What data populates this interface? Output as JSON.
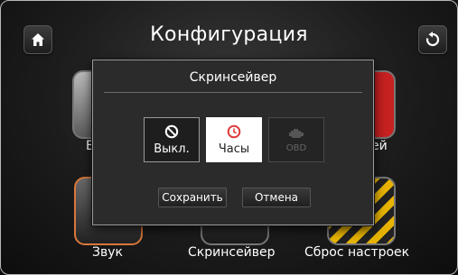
{
  "header": {
    "title": "Конфигурация",
    "home_icon": "home-icon",
    "back_icon": "back-refresh-icon"
  },
  "background_tiles": [
    {
      "label": "В"
    },
    {
      "label": "ей"
    },
    {
      "label": "Звук"
    },
    {
      "label": "Скринсейвер"
    },
    {
      "label": "Сброс настроек"
    }
  ],
  "modal": {
    "title": "Скринсейвер",
    "options": [
      {
        "label": "Выкл.",
        "icon": "no-icon",
        "selected": false,
        "enabled": true
      },
      {
        "label": "Часы",
        "icon": "clock-icon",
        "selected": true,
        "enabled": true
      },
      {
        "label": "OBD",
        "icon": "engine-icon",
        "selected": false,
        "enabled": false
      }
    ],
    "save_label": "Сохранить",
    "cancel_label": "Отмена"
  },
  "colors": {
    "accent_red": "#e03b3b",
    "selected_bg": "#ffffff",
    "modal_bg": "#2b2b2b"
  }
}
